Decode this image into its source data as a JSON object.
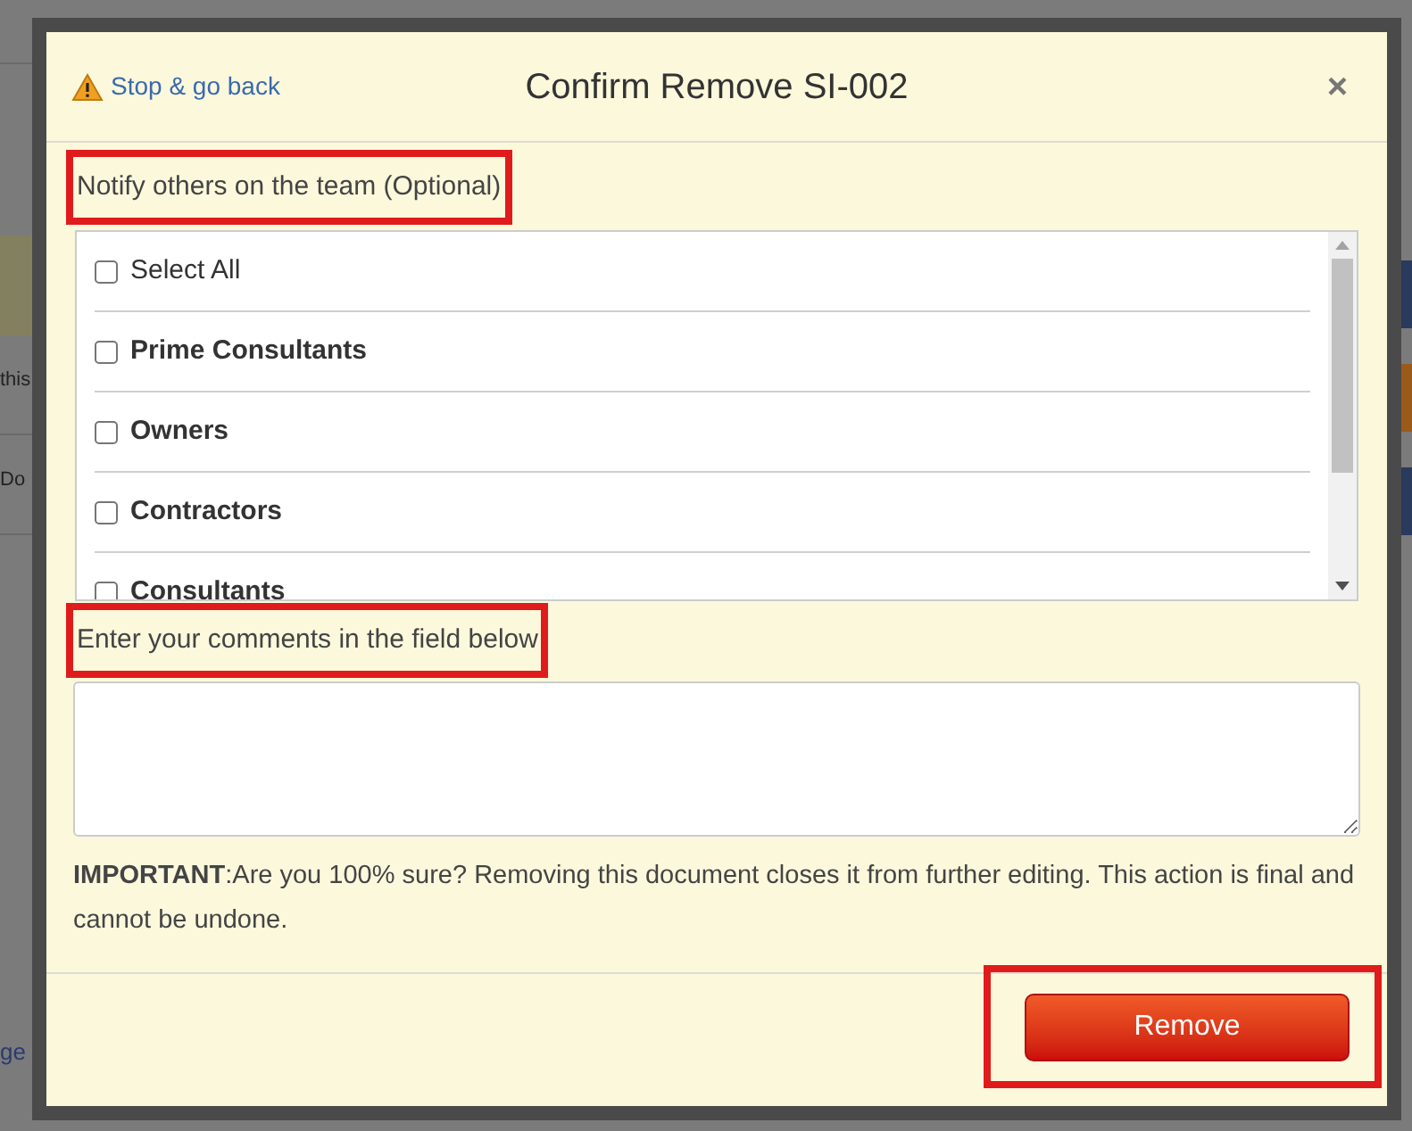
{
  "background": {
    "left_fragments": [
      "this",
      "Do"
    ],
    "left_link": "ge",
    "right_buttons": [
      {
        "color": "#2a3a5c"
      },
      {
        "color": "#9a5a1a"
      },
      {
        "color": "#2a3a5c"
      }
    ]
  },
  "dialog": {
    "back_link": "Stop & go back",
    "title": "Confirm Remove SI-002",
    "close": "×",
    "notify_label": {
      "text": "Notify others on the team (Optional)",
      "highlighted": true
    },
    "recipients": [
      {
        "label": "Select All",
        "bold": false,
        "checked": false
      },
      {
        "label": "Prime Consultants",
        "bold": true,
        "checked": false
      },
      {
        "label": "Owners",
        "bold": true,
        "checked": false
      },
      {
        "label": "Contractors",
        "bold": true,
        "checked": false
      },
      {
        "label": "Consultants",
        "bold": true,
        "checked": false
      }
    ],
    "comments_label": {
      "text": "Enter your comments in the field below",
      "highlighted": true
    },
    "warning": "**IMPORTANT**:Are you 100% sure? Removing this document closes it from further editing. This action is final and cannot be undone.",
    "remove_button": {
      "label": "Remove",
      "highlighted": true
    }
  }
}
